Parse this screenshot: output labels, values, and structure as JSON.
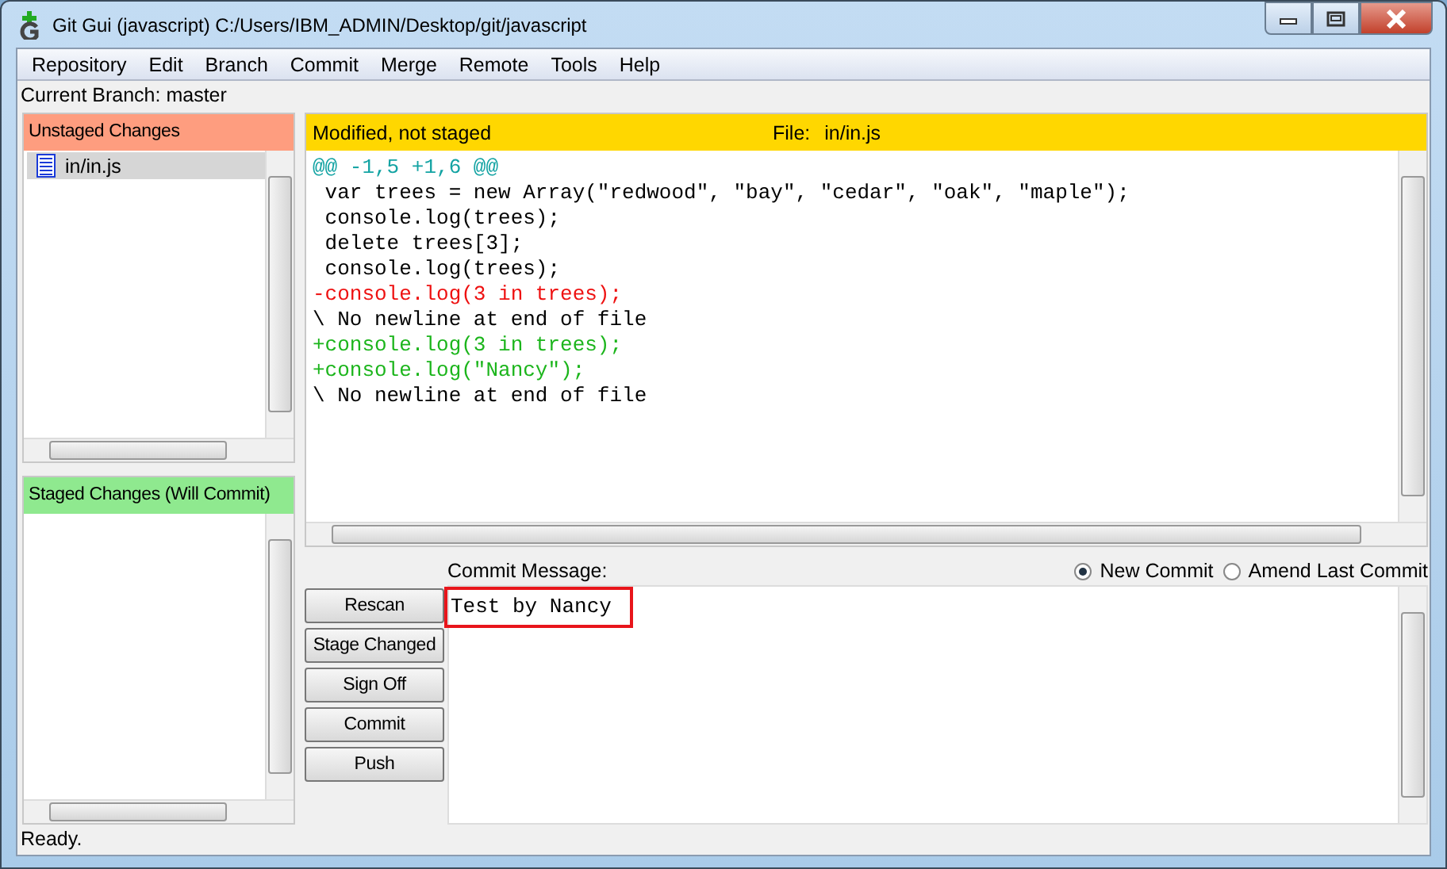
{
  "window": {
    "title": "Git Gui (javascript) C:/Users/IBM_ADMIN/Desktop/git/javascript"
  },
  "menu": [
    "Repository",
    "Edit",
    "Branch",
    "Commit",
    "Merge",
    "Remote",
    "Tools",
    "Help"
  ],
  "current_branch": "Current Branch: master",
  "unstaged": {
    "title": "Unstaged Changes",
    "files": [
      {
        "name": "in/in.js",
        "selected": true
      }
    ]
  },
  "staged": {
    "title": "Staged Changes (Will Commit)"
  },
  "diff": {
    "status": "Modified, not staged",
    "file_label": "File:",
    "file": "in/in.js",
    "lines": [
      {
        "kind": "hunk",
        "text": "@@ -1,5 +1,6 @@"
      },
      {
        "kind": "context",
        "text": " var trees = new Array(\"redwood\", \"bay\", \"cedar\", \"oak\", \"maple\");"
      },
      {
        "kind": "context",
        "text": " console.log(trees);"
      },
      {
        "kind": "context",
        "text": " delete trees[3];"
      },
      {
        "kind": "context",
        "text": " console.log(trees);"
      },
      {
        "kind": "removed",
        "text": "-console.log(3 in trees);"
      },
      {
        "kind": "context",
        "text": "\\ No newline at end of file"
      },
      {
        "kind": "added",
        "text": "+console.log(3 in trees);"
      },
      {
        "kind": "added",
        "text": "+console.log(\"Nancy\");"
      },
      {
        "kind": "context",
        "text": "\\ No newline at end of file"
      }
    ]
  },
  "commit": {
    "label": "Commit Message:",
    "modes": [
      {
        "label": "New Commit",
        "selected": true
      },
      {
        "label": "Amend Last Commit",
        "selected": false
      }
    ],
    "buttons": [
      "Rescan",
      "Stage Changed",
      "Sign Off",
      "Commit",
      "Push"
    ],
    "message": "Test by Nancy",
    "highlighted": true
  },
  "status_bar": "Ready."
}
